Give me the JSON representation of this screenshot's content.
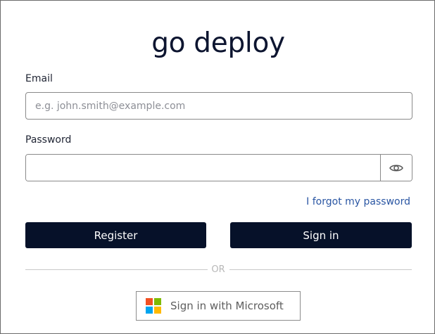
{
  "app": {
    "title": "go deploy"
  },
  "form": {
    "email_label": "Email",
    "email_placeholder": "e.g. john.smith@example.com",
    "email_value": "",
    "password_label": "Password",
    "password_value": "",
    "show_password_icon": "eye-icon",
    "forgot_link": "I forgot my password"
  },
  "actions": {
    "register_label": "Register",
    "signin_label": "Sign in",
    "divider_text": "OR",
    "microsoft_label": "Sign in with Microsoft",
    "microsoft_logo_colors": [
      "#f25022",
      "#7fba00",
      "#00a4ef",
      "#ffb900"
    ]
  },
  "colors": {
    "primary_button": "#061129",
    "link": "#2a56a3"
  }
}
